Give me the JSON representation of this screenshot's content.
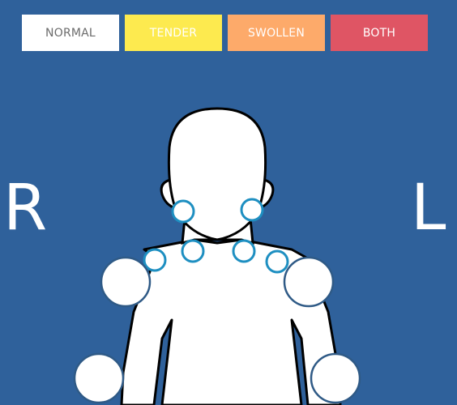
{
  "legend": {
    "items": [
      {
        "label": "NORMAL",
        "bg": "#ffffff",
        "fg": "#6b6b6b"
      },
      {
        "label": "TENDER",
        "bg": "#fdea4f",
        "fg": "#ffffff"
      },
      {
        "label": "SWOLLEN",
        "bg": "#fdaa6a",
        "fg": "#ffffff"
      },
      {
        "label": "BOTH",
        "bg": "#df5564",
        "fg": "#ffffff"
      }
    ]
  },
  "sides": {
    "right": "R",
    "left": "L"
  },
  "colors": {
    "background": "#2f619b",
    "small_joint_stroke": "#1e8fc1",
    "large_joint_stroke": "#2f5a86",
    "body_outline": "#000000",
    "body_fill": "#ffffff"
  }
}
